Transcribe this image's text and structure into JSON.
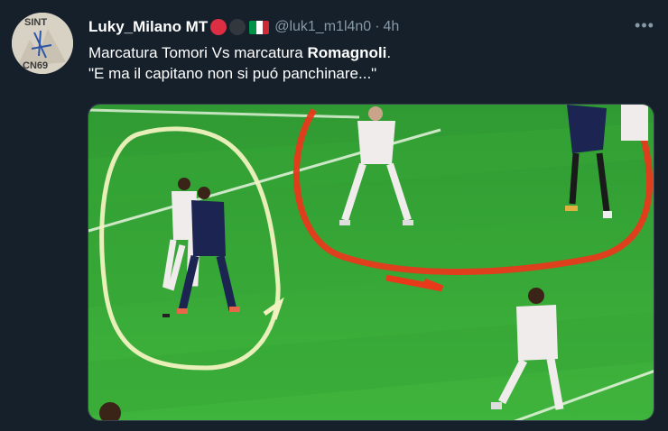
{
  "tweet": {
    "display_name": "Luky_Milano MT",
    "handle": "@luk1_m1l4n0",
    "separator": "·",
    "time": "4h",
    "more_label": "•••",
    "text_line1_prefix": "Marcatura Tomori Vs marcatura ",
    "text_line1_bold": "Romagnoli",
    "text_line1_suffix": ".",
    "text_line2": "\"E ma il capitano non si puó panchinare...\"",
    "avatar_text_top": "SINT",
    "avatar_text_bottom": "CN69"
  },
  "emojis": [
    "red-circle-icon",
    "black-circle-icon",
    "italy-flag-icon"
  ],
  "colors": {
    "background": "#15202b",
    "muted": "#8899a6",
    "pitch": "#3aa83a",
    "highlight_yellow": "#f2f2c0",
    "highlight_red": "#e8391b",
    "kit_white": "#f0ecec",
    "kit_navy": "#1c2452"
  }
}
